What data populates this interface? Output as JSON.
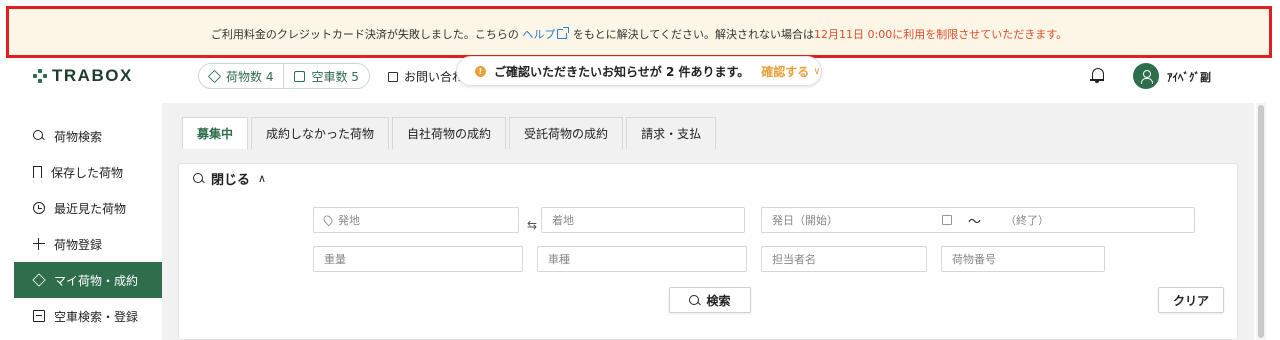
{
  "alert": {
    "prefix": "ご利用料金のクレジットカード決済が失敗しました。こちらの",
    "link_label": "ヘルプ",
    "middle": "をもとに解決してください。解決されない場合は",
    "deadline": "12月11日 0:00に利用を制限させていただきます。"
  },
  "header": {
    "logo": "TRABOX",
    "cargo_count": "荷物数 4",
    "truck_count": "空車数 5",
    "inquiry": "お問い合わせ",
    "notice_text": "ご確認いただきたいお知らせが 2 件あります。",
    "notice_action": "確認する",
    "username": "ｱｲﾍﾞｸﾞ副"
  },
  "sidebar": {
    "items": [
      {
        "label": "荷物検索",
        "icon": "search-icon"
      },
      {
        "label": "保存した荷物",
        "icon": "bookmark-icon"
      },
      {
        "label": "最近見た荷物",
        "icon": "clock-icon"
      },
      {
        "label": "荷物登録",
        "icon": "plus-icon"
      },
      {
        "label": "マイ荷物・成約",
        "icon": "cube-icon",
        "active": true
      },
      {
        "label": "空車検索・登録",
        "icon": "truck-icon"
      }
    ]
  },
  "tabs": [
    {
      "label": "募集中",
      "active": true
    },
    {
      "label": "成約しなかった荷物"
    },
    {
      "label": "自社荷物の成約"
    },
    {
      "label": "受託荷物の成約"
    },
    {
      "label": "請求・支払"
    }
  ],
  "search": {
    "toggle_label": "閉じる",
    "origin_placeholder": "発地",
    "destination_placeholder": "着地",
    "date_start_placeholder": "発日（開始）",
    "tilde": "〜",
    "date_end_placeholder": "（終了）",
    "weight_placeholder": "重量",
    "vehicle_placeholder": "車種",
    "staff_placeholder": "担当者名",
    "cargo_no_placeholder": "荷物番号",
    "search_button": "検索",
    "clear_button": "クリア"
  },
  "colors": {
    "brand": "#2f6e4d",
    "alert_border": "#e02020",
    "alert_bg": "#fbf6e6",
    "link": "#2b7bd6",
    "deadline": "#e24b2a",
    "notice_accent": "#e9a23b"
  }
}
